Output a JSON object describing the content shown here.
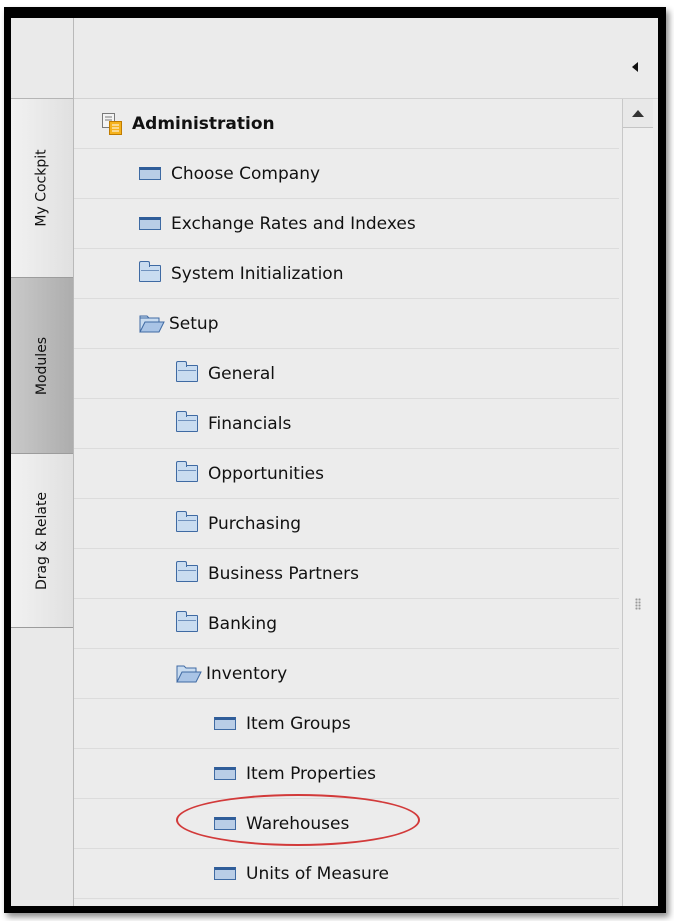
{
  "side_tabs": {
    "my_cockpit": "My Cockpit",
    "modules": "Modules",
    "drag_relate": "Drag & Relate"
  },
  "tree": {
    "root": {
      "label": "Administration",
      "icon": "module-icon"
    },
    "items": [
      {
        "label": "Choose Company",
        "icon": "form-icon"
      },
      {
        "label": "Exchange Rates and Indexes",
        "icon": "form-icon"
      },
      {
        "label": "System Initialization",
        "icon": "folder-icon"
      },
      {
        "label": "Setup",
        "icon": "folder-open-icon"
      },
      {
        "label": "General",
        "icon": "folder-icon"
      },
      {
        "label": "Financials",
        "icon": "folder-icon"
      },
      {
        "label": "Opportunities",
        "icon": "folder-icon"
      },
      {
        "label": "Purchasing",
        "icon": "folder-icon"
      },
      {
        "label": "Business Partners",
        "icon": "folder-icon"
      },
      {
        "label": "Banking",
        "icon": "folder-icon"
      },
      {
        "label": "Inventory",
        "icon": "folder-open-icon"
      },
      {
        "label": "Item Groups",
        "icon": "form-icon"
      },
      {
        "label": "Item Properties",
        "icon": "form-icon"
      },
      {
        "label": "Warehouses",
        "icon": "form-icon",
        "highlighted": true
      },
      {
        "label": "Units of Measure",
        "icon": "form-icon"
      }
    ]
  },
  "colors": {
    "highlight_ring": "#d23a3a",
    "active_tab": "#b9b9b9"
  }
}
